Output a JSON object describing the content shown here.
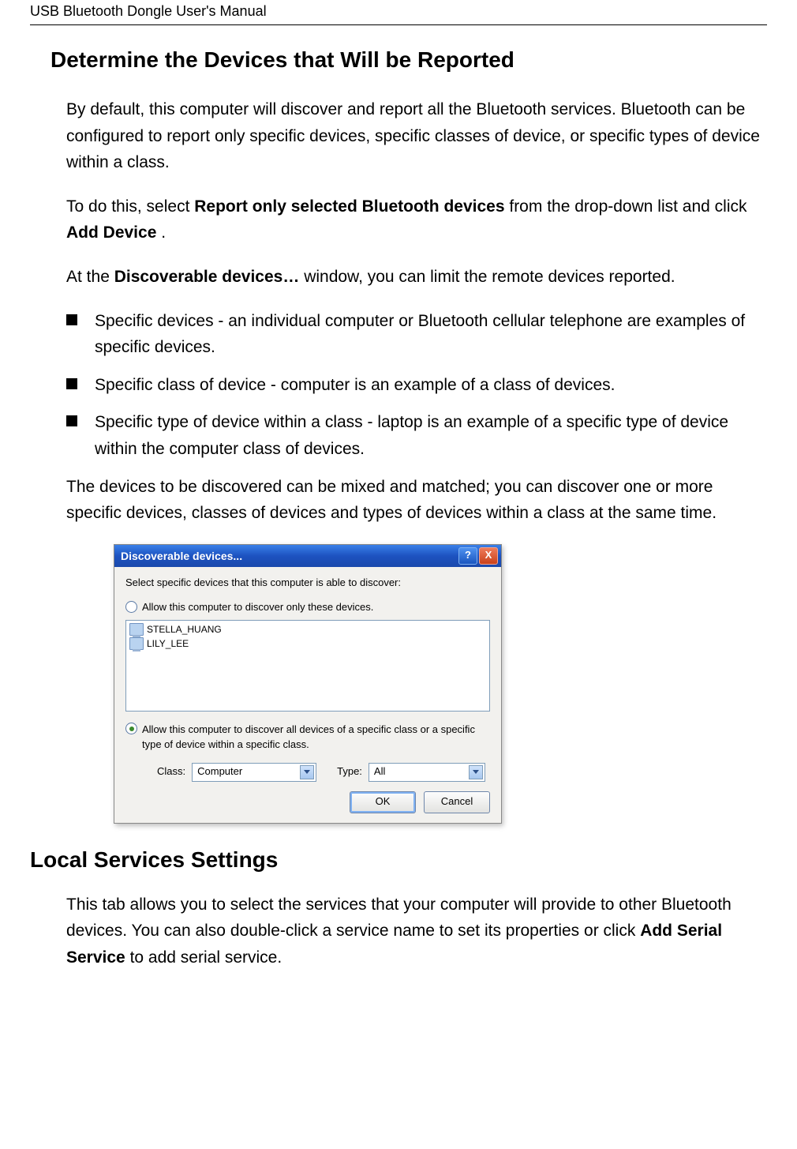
{
  "running_head": "USB Bluetooth Dongle User's Manual",
  "section_title": "Determine the Devices that Will be Reported",
  "p1": "By default, this computer will discover and report all the Bluetooth services. Bluetooth can be configured to report only specific devices, specific classes of device, or specific types of device within a class.",
  "p2_a": "To do this, select ",
  "p2_bold1": "Report only selected Bluetooth devices",
  "p2_b": " from the drop-down list and click ",
  "p2_bold2": "Add Device",
  "p2_c": ".",
  "p3_a": "At the ",
  "p3_bold": "Discoverable devices…",
  "p3_b": " window, you can limit the remote devices reported.",
  "bullets": [
    "Specific devices - an individual computer or Bluetooth cellular telephone are examples of specific devices.",
    "Specific class of device - computer is an example of a class of devices.",
    "Specific type of device within a class - laptop is an example of a specific type of device within the computer class of devices."
  ],
  "p4": "The devices to be discovered can be mixed and matched; you can discover one or more specific devices, classes of devices and types of devices within a class at the same time.",
  "dialog": {
    "title": "Discoverable devices...",
    "help_glyph": "?",
    "close_glyph": "X",
    "instruction": "Select specific devices that this computer is able to discover:",
    "radio1_label": "Allow this computer to discover only these devices.",
    "devices": [
      "STELLA_HUANG",
      "LILY_LEE"
    ],
    "radio2_label": "Allow this computer to discover all devices of a specific class or a specific type of device within a specific class.",
    "class_label": "Class:",
    "class_value": "Computer",
    "type_label": "Type:",
    "type_value": "All",
    "ok_label": "OK",
    "cancel_label": "Cancel"
  },
  "section2_title": "Local Services Settings",
  "p5_a": "This tab allows you to select the services that your computer will provide to other Bluetooth devices. You can also double-click a service name to set its properties or click ",
  "p5_bold": "Add Serial Service",
  "p5_b": " to add serial service."
}
